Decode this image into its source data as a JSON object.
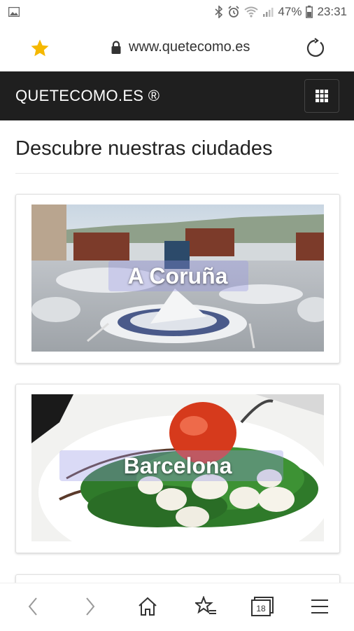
{
  "status_bar": {
    "battery_percent": "47%",
    "time": "23:31"
  },
  "browser": {
    "url": "www.quetecomo.es",
    "icons": [
      "star-icon",
      "lock-icon",
      "reload-icon"
    ]
  },
  "site": {
    "brand": "QUETECOMO.ES ®",
    "menu_icon": "grid-icon"
  },
  "main": {
    "title": "Descubre nuestras ciudades",
    "cities": [
      {
        "label": "A Coruña"
      },
      {
        "label": "Barcelona"
      }
    ]
  },
  "bottom_nav": {
    "tabs_count": "18",
    "items": [
      "back-icon",
      "forward-icon",
      "home-icon",
      "bookmarks-icon",
      "tabs-icon",
      "menu-icon"
    ]
  },
  "colors": {
    "header_bg": "#1f1f1f",
    "star": "#f5b800",
    "page_bg": "#ffffff"
  }
}
